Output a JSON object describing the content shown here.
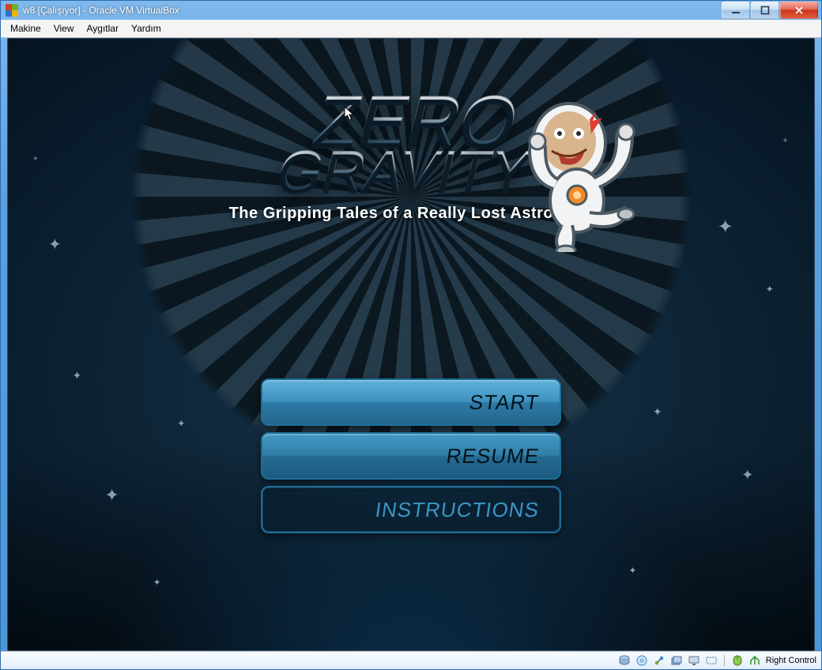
{
  "window": {
    "title": "w8 [Çalışıyor] - Oracle VM VirtualBox"
  },
  "menubar": {
    "items": [
      "Makine",
      "View",
      "Aygıtlar",
      "Yardım"
    ]
  },
  "game": {
    "logo_line1": "ZERO",
    "logo_line2": "GRAVITY",
    "tagline": "The Gripping Tales of a Really Lost Astronaut.",
    "buttons": {
      "start": "START",
      "resume": "RESUME",
      "instructions": "INSTRUCTIONS"
    }
  },
  "statusbar": {
    "host_key": "Right Control"
  }
}
